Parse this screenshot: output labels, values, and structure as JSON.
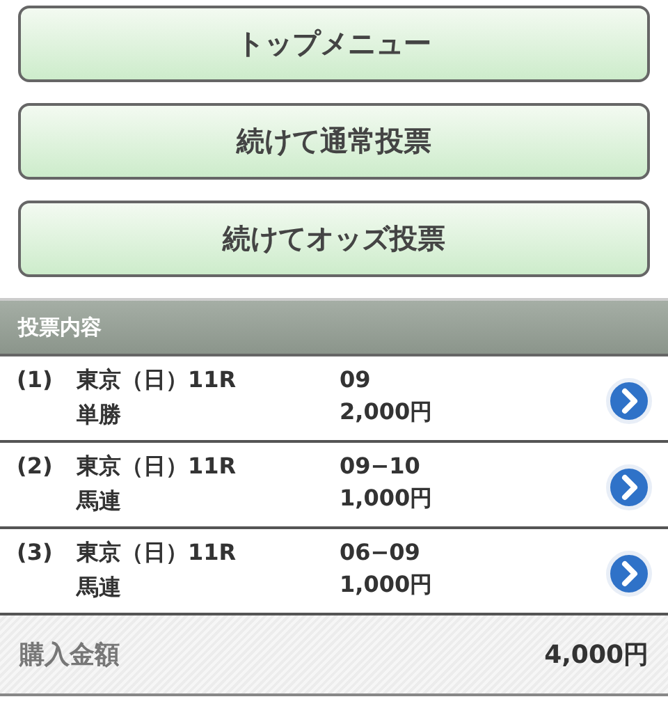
{
  "buttons": [
    "トップメニュー",
    "続けて通常投票",
    "続けてオッズ投票"
  ],
  "section": {
    "title": "投票内容"
  },
  "bets": [
    {
      "number": "(1)",
      "race": "東京（日）11R",
      "type": "単勝",
      "selection": "09",
      "amount": "2,000円"
    },
    {
      "number": "(2)",
      "race": "東京（日）11R",
      "type": "馬連",
      "selection": "09−10",
      "amount": "1,000円"
    },
    {
      "number": "(3)",
      "race": "東京（日）11R",
      "type": "馬連",
      "selection": "06−09",
      "amount": "1,000円"
    }
  ],
  "total": {
    "label": "購入金額",
    "amount": "4,000円"
  }
}
